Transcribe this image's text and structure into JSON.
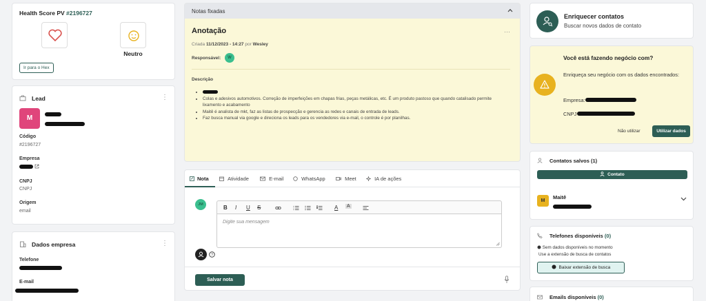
{
  "health": {
    "title": "Health Score PV",
    "id": "#2196727",
    "sentiment_label": "Neutro",
    "hex_button": "Ir para o Hex"
  },
  "lead": {
    "section_title": "Lead",
    "avatar_letter": "M",
    "fields": [
      {
        "label": "Código",
        "value": "#2196727"
      },
      {
        "label": "Empresa",
        "value": ""
      },
      {
        "label": "CNPJ",
        "value": "CNPJ"
      },
      {
        "label": "Origem",
        "value": "email"
      }
    ]
  },
  "company": {
    "section_title": "Dados empresa",
    "phone_label": "Telefone",
    "email_label": "E-mail"
  },
  "pinned": {
    "header": "Notas fixadas",
    "note_title": "Anotação",
    "created_prefix": "Criada",
    "created_date": "11/12/2023 - 14:27",
    "created_by_prefix": "por",
    "author": "Wesley",
    "responsible_label": "Responsável:",
    "responsible_initial": "W",
    "description_label": "Descrição",
    "bullets": [
      "Colas e adesivos automotivos. Correção de imperfeições em chapas frias, peças metálicas, etc. É um produto pastoso que quando catalisado permite lixamento e acabamento",
      "Maitê é analista de mkt, faz as listas de prospecção e gerencia as redes e canais de entrada de leads.",
      "Faz busca manual via google e direciona os leads para os vendedores via e-mail, o controle é por planilhas."
    ]
  },
  "composer": {
    "tabs": [
      "Nota",
      "Atividade",
      "E-mail",
      "WhatsApp",
      "Meet",
      "IA de ações"
    ],
    "avatar_initials": "JM",
    "placeholder": "Digite sua mensagem",
    "save_button": "Salvar nota"
  },
  "enrich": {
    "title": "Enriquecer contatos",
    "subtitle": "Buscar novos dados de contato"
  },
  "business": {
    "question": "Você está fazendo negócio com?",
    "body": "Enriqueça seu negócio com os dados encontrados:",
    "company_label": "Empresa:",
    "cnpj_label": "CNPJ",
    "decline": "Não utilizar",
    "accept": "Utilizar dados"
  },
  "saved_contacts": {
    "title": "Contatos salvos (1)",
    "add_button": "Contato",
    "contact_initial": "M",
    "contact_name": "Maitê"
  },
  "phones": {
    "title": "Telefones disponíveis",
    "count": "(0)",
    "no_data": "Sem dados disponíveis no momento",
    "hint": "Use a extensão de busca de contatos",
    "button": "Baixar extensão de busca"
  },
  "emails": {
    "title": "Emails disponíveis",
    "count": "(0)"
  },
  "colors": {
    "teal": "#2d5e55",
    "note_bg": "#fbf8d8",
    "warning": "#e8b21f",
    "avatar_pink": "#e0457b",
    "avatar_green": "#3bbf8f"
  }
}
